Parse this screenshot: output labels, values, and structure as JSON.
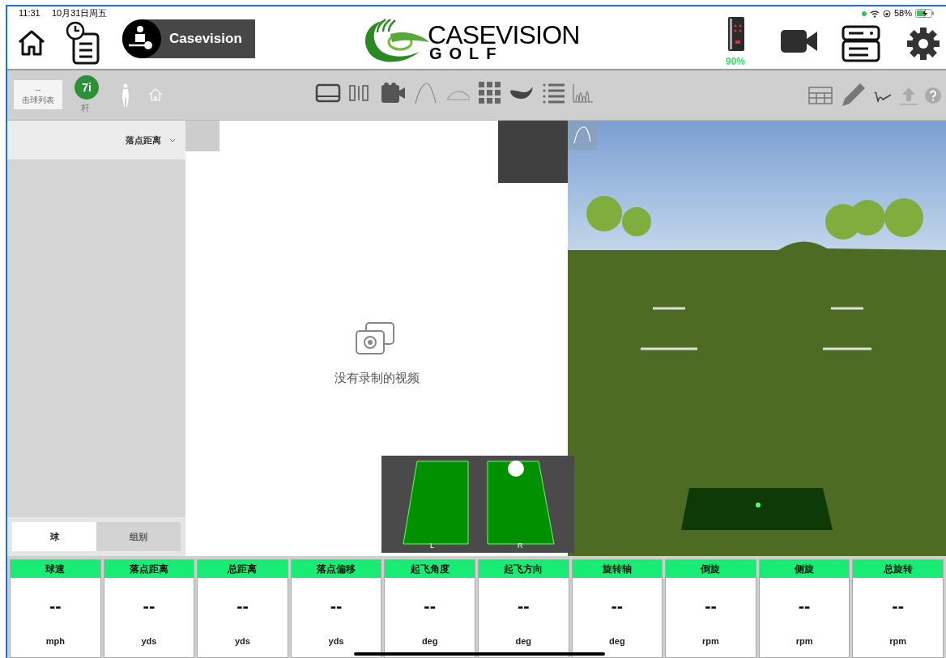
{
  "status_bar": {
    "time": "11:31",
    "date": "10月31日周五",
    "battery": "58%"
  },
  "header": {
    "account_name": "Casevision",
    "logo_title": "CASEVISION",
    "logo_subtitle": "GOLF",
    "device_battery": "90%"
  },
  "toolbar": {
    "shot_list_value": "--",
    "shot_list_label": "击球列表",
    "club_badge": "7i",
    "club_label": "杆"
  },
  "sidebar": {
    "sort_dropdown": "落点距离",
    "tabs": [
      {
        "label": "球",
        "selected": true
      },
      {
        "label": "组别",
        "selected": false
      }
    ]
  },
  "video_panel": {
    "empty_message": "没有录制的视频"
  },
  "impact_overlay": {
    "left_label": "L",
    "right_label": "R"
  },
  "metrics": [
    {
      "name": "球速",
      "value": "--",
      "unit": "mph"
    },
    {
      "name": "落点距离",
      "value": "--",
      "unit": "yds"
    },
    {
      "name": "总距离",
      "value": "--",
      "unit": "yds"
    },
    {
      "name": "落点偏移",
      "value": "--",
      "unit": "yds"
    },
    {
      "name": "起飞角度",
      "value": "--",
      "unit": "deg"
    },
    {
      "name": "起飞方向",
      "value": "--",
      "unit": "deg"
    },
    {
      "name": "旋转轴",
      "value": "--",
      "unit": "deg"
    },
    {
      "name": "倒旋",
      "value": "--",
      "unit": "rpm"
    },
    {
      "name": "侧旋",
      "value": "--",
      "unit": "rpm"
    },
    {
      "name": "总旋转",
      "value": "--",
      "unit": "rpm"
    }
  ]
}
